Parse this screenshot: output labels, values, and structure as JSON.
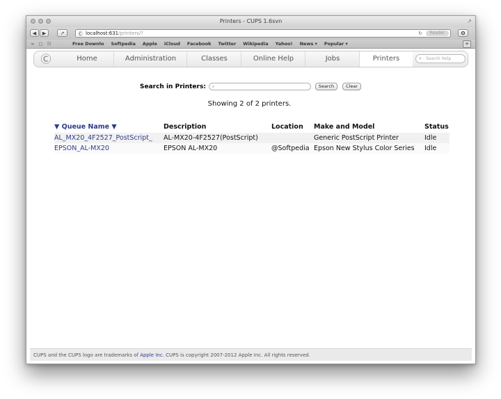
{
  "window": {
    "title": "Printers - CUPS 1.6svn"
  },
  "browser": {
    "url_host": "localhost:631",
    "url_path": "/printers/?",
    "reader_label": "Reader",
    "bookmarks": [
      "Free Downlo",
      "Softpedia",
      "Apple",
      "iCloud",
      "Facebook",
      "Twitter",
      "Wikipedia",
      "Yahoo!",
      "News ▾",
      "Popular ▾"
    ]
  },
  "nav": {
    "tabs": [
      "Home",
      "Administration",
      "Classes",
      "Online Help",
      "Jobs",
      "Printers"
    ],
    "active_tab": "Printers",
    "search_placeholder": "Search Help"
  },
  "search": {
    "label": "Search in Printers:",
    "search_button": "Search",
    "clear_button": "Clear"
  },
  "summary": "Showing 2 of 2 printers.",
  "table": {
    "columns": [
      "▼ Queue Name ▼",
      "Description",
      "Location",
      "Make and Model",
      "Status"
    ],
    "rows": [
      {
        "queue": "AL_MX20_4F2527_PostScript_",
        "description": "AL-MX20-4F2527(PostScript)",
        "location": "",
        "model": "Generic PostScript Printer",
        "status": "Idle"
      },
      {
        "queue": "EPSON_AL-MX20",
        "description": "EPSON AL-MX20",
        "location": "@Softpedia",
        "model": "Epson New Stylus Color Series",
        "status": "Idle"
      }
    ]
  },
  "footer": {
    "prefix": "CUPS and the CUPS logo are trademarks of ",
    "link": "Apple Inc.",
    "suffix": " CUPS is copyright 2007-2012 Apple Inc. All rights reserved."
  },
  "colors": {
    "link": "#2c3c8c",
    "nav_bg": "#efefef"
  }
}
